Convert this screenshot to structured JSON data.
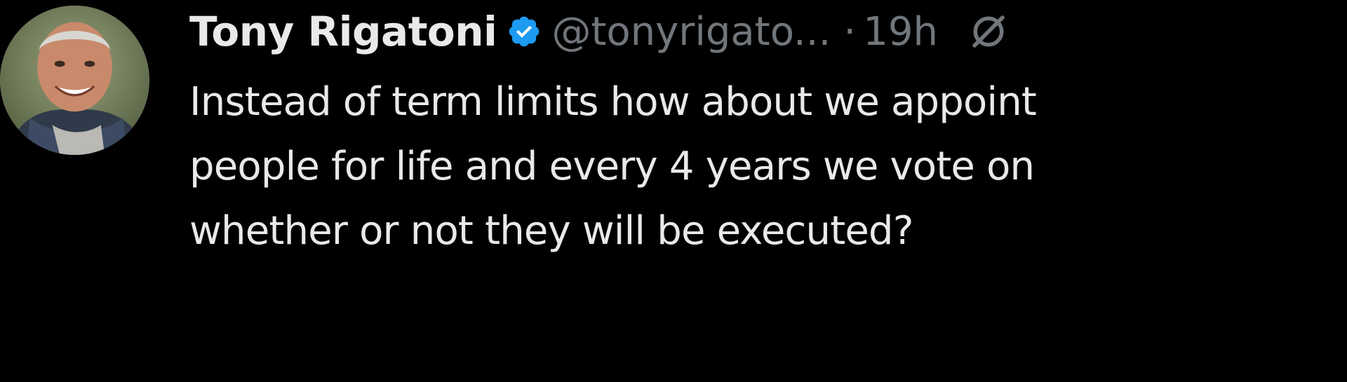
{
  "tweet": {
    "author": {
      "display_name": "Tony Rigatoni",
      "handle": "@tonyrigato...",
      "verified": true
    },
    "separator": "·",
    "timestamp": "19h",
    "text_lines": [
      "Instead of term limits how about we appoint",
      "people for life and every 4 years we vote on",
      "whether or not they will be executed?"
    ]
  },
  "icons": {
    "avatar": "avatar-photo",
    "verified": "verified-badge-icon",
    "grok": "grok-icon"
  },
  "colors": {
    "background": "#000000",
    "primary_text": "#e7e9ea",
    "secondary_text": "#71767b",
    "verified_blue": "#1d9bf0"
  }
}
